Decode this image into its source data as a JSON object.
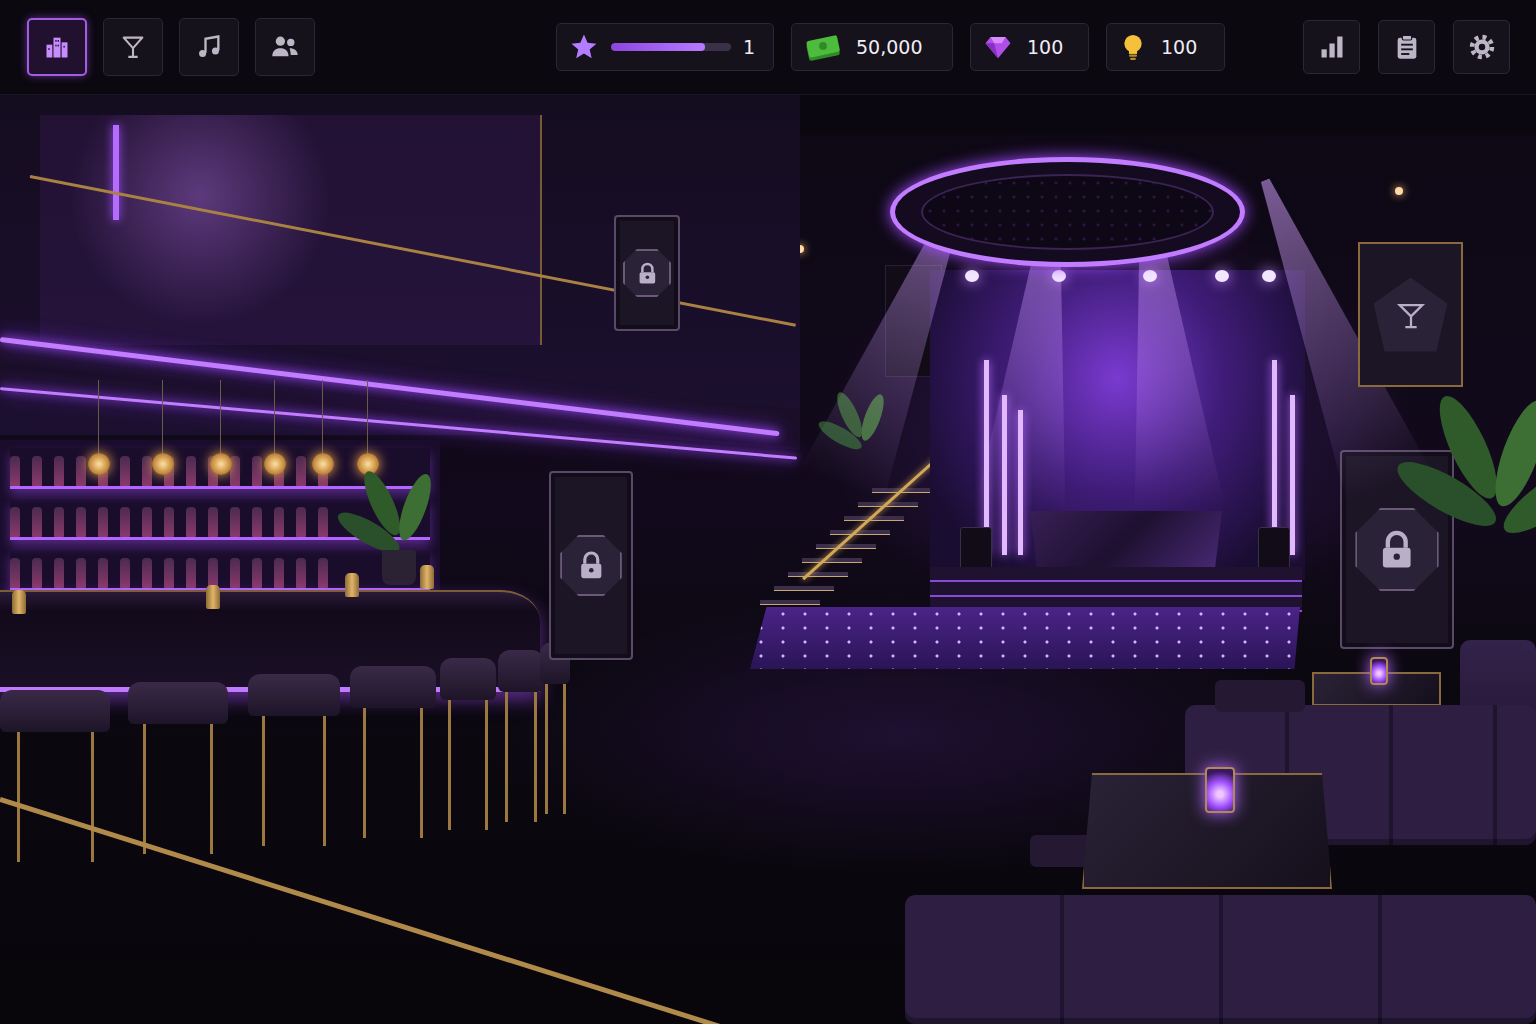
{
  "top_bar": {
    "nav": [
      {
        "kind": "club",
        "selected": true
      },
      {
        "kind": "bar",
        "selected": false
      },
      {
        "kind": "music",
        "selected": false
      },
      {
        "kind": "staff",
        "selected": false
      }
    ],
    "level": {
      "value": "1",
      "level": 0.78
    },
    "currencies": [
      {
        "kind": "cash",
        "amount": "50,000"
      },
      {
        "kind": "gems",
        "amount": "100"
      },
      {
        "kind": "ideas",
        "amount": "100"
      }
    ],
    "tools": [
      {
        "kind": "stats"
      },
      {
        "kind": "tasks"
      },
      {
        "kind": "settings"
      }
    ]
  },
  "scene": {
    "doors": [
      {
        "locked": true
      },
      {
        "locked": true
      },
      {
        "locked": true
      }
    ]
  }
}
